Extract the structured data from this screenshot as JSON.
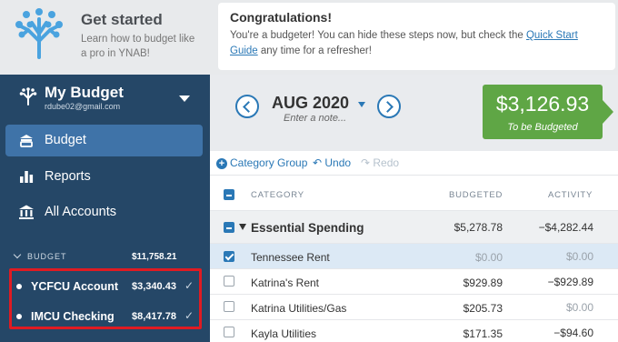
{
  "banner": {
    "title": "Get started",
    "subtitle": "Learn how to budget like a pro in YNAB!",
    "congrats_title": "Congratulations!",
    "congrats_text_before": "You're a budgeter! You can hide these steps now, but check the ",
    "congrats_link": "Quick Start Guide",
    "congrats_text_after": " any time for a refresher!"
  },
  "sidebar": {
    "budget_name": "My Budget",
    "email": "rdube02@gmail.com",
    "nav": [
      {
        "label": "Budget",
        "icon": "budget-icon",
        "active": true
      },
      {
        "label": "Reports",
        "icon": "reports-icon",
        "active": false
      },
      {
        "label": "All Accounts",
        "icon": "bank-icon",
        "active": false
      }
    ],
    "section_label": "BUDGET",
    "section_total": "$11,758.21",
    "accounts": [
      {
        "name": "YCFCU Account",
        "balance": "$3,340.43"
      },
      {
        "name": "IMCU Checking",
        "balance": "$8,417.78"
      }
    ]
  },
  "header": {
    "month": "AUG 2020",
    "note_placeholder": "Enter a note...",
    "to_be_budgeted_amount": "$3,126.93",
    "to_be_budgeted_label": "To be Budgeted"
  },
  "toolbar": {
    "category_group": "Category Group",
    "undo": "Undo",
    "redo": "Redo"
  },
  "table": {
    "columns": [
      "CATEGORY",
      "BUDGETED",
      "ACTIVITY"
    ],
    "group": {
      "name": "Essential Spending",
      "budgeted": "$5,278.78",
      "activity": "−$4,282.44"
    },
    "rows": [
      {
        "name": "Tennessee Rent",
        "budgeted": "$0.00",
        "activity": "$0.00",
        "selected": true
      },
      {
        "name": "Katrina's Rent",
        "budgeted": "$929.89",
        "activity": "−$929.89",
        "selected": false
      },
      {
        "name": "Katrina Utilities/Gas",
        "budgeted": "$205.73",
        "activity": "$0.00",
        "selected": false
      },
      {
        "name": "Kayla Utilities",
        "budgeted": "$171.35",
        "activity": "−$94.60",
        "selected": false
      }
    ]
  },
  "colors": {
    "sidebar": "#254767",
    "accent": "#2a78b6",
    "to_be_budgeted": "#5fa645",
    "highlight_box": "#e01b22"
  }
}
